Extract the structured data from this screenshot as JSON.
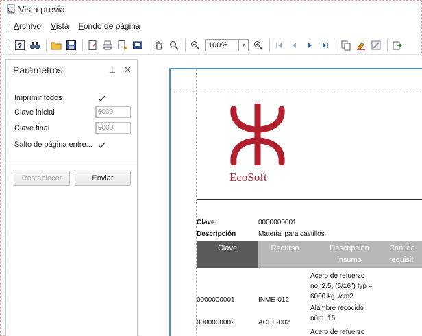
{
  "window": {
    "title": "Vista previa"
  },
  "menu": [
    {
      "underline": "A",
      "rest": "rchivo"
    },
    {
      "underline": "V",
      "rest": "ista"
    },
    {
      "underline": "F",
      "rest": "ondo de página"
    }
  ],
  "toolbar": {
    "zoom_value": "100%",
    "icons": [
      "help-icon",
      "binoculars-icon",
      "open-folder-icon",
      "save-icon",
      "page-setup-icon",
      "print-icon",
      "quick-print-icon",
      "export-icon",
      "hand-icon",
      "magnifier-icon",
      "zoom-out-icon",
      "zoom-in-icon",
      "first-page-icon",
      "previous-page-icon",
      "next-page-icon",
      "last-page-icon",
      "multiple-pages-icon",
      "color-icon",
      "watermark-icon",
      "export-document-icon"
    ]
  },
  "panel": {
    "title": "Parámetros",
    "params": [
      {
        "label": "Imprimir todos",
        "type": "checkbox",
        "checked": true
      },
      {
        "label": "Clave inicial",
        "type": "combo",
        "value": "0000"
      },
      {
        "label": "Clave final",
        "type": "combo",
        "value": "0000"
      },
      {
        "label": "Salto de página entre...",
        "type": "checkbox",
        "checked": true
      }
    ],
    "reset_label": "Restablecer",
    "send_label": "Enviar"
  },
  "report": {
    "logo_text": "EcoSoft",
    "clave_label": "Clave",
    "clave_value": "0000000001",
    "descripcion_label": "Descripción",
    "descripcion_value": "Material para castillos",
    "columns": [
      {
        "line1": "Clave",
        "line2": ""
      },
      {
        "line1": "Recurso",
        "line2": ""
      },
      {
        "line1": "Descripción",
        "line2": "insumo"
      },
      {
        "line1": "Cantida",
        "line2": "requisit"
      }
    ],
    "rows": [
      {
        "clave": "0000000001",
        "recurso": "INME-012",
        "desc": [
          "Acero de refuerzo",
          "no. 2.5, (5/16\") fyp =",
          "6000 kg. /cm2"
        ]
      },
      {
        "clave": "0000000002",
        "recurso": "ACEL-002",
        "desc": [
          "Alambre recocido",
          "núm. 16"
        ]
      },
      {
        "clave": "",
        "recurso": "",
        "desc": [
          "Acero de refuerzo"
        ]
      }
    ]
  },
  "colors": {
    "accent": "#4a90c8",
    "logo": "#b21f2d",
    "header_dark": "#5a5a5a",
    "header_light": "#b8b8b8"
  }
}
